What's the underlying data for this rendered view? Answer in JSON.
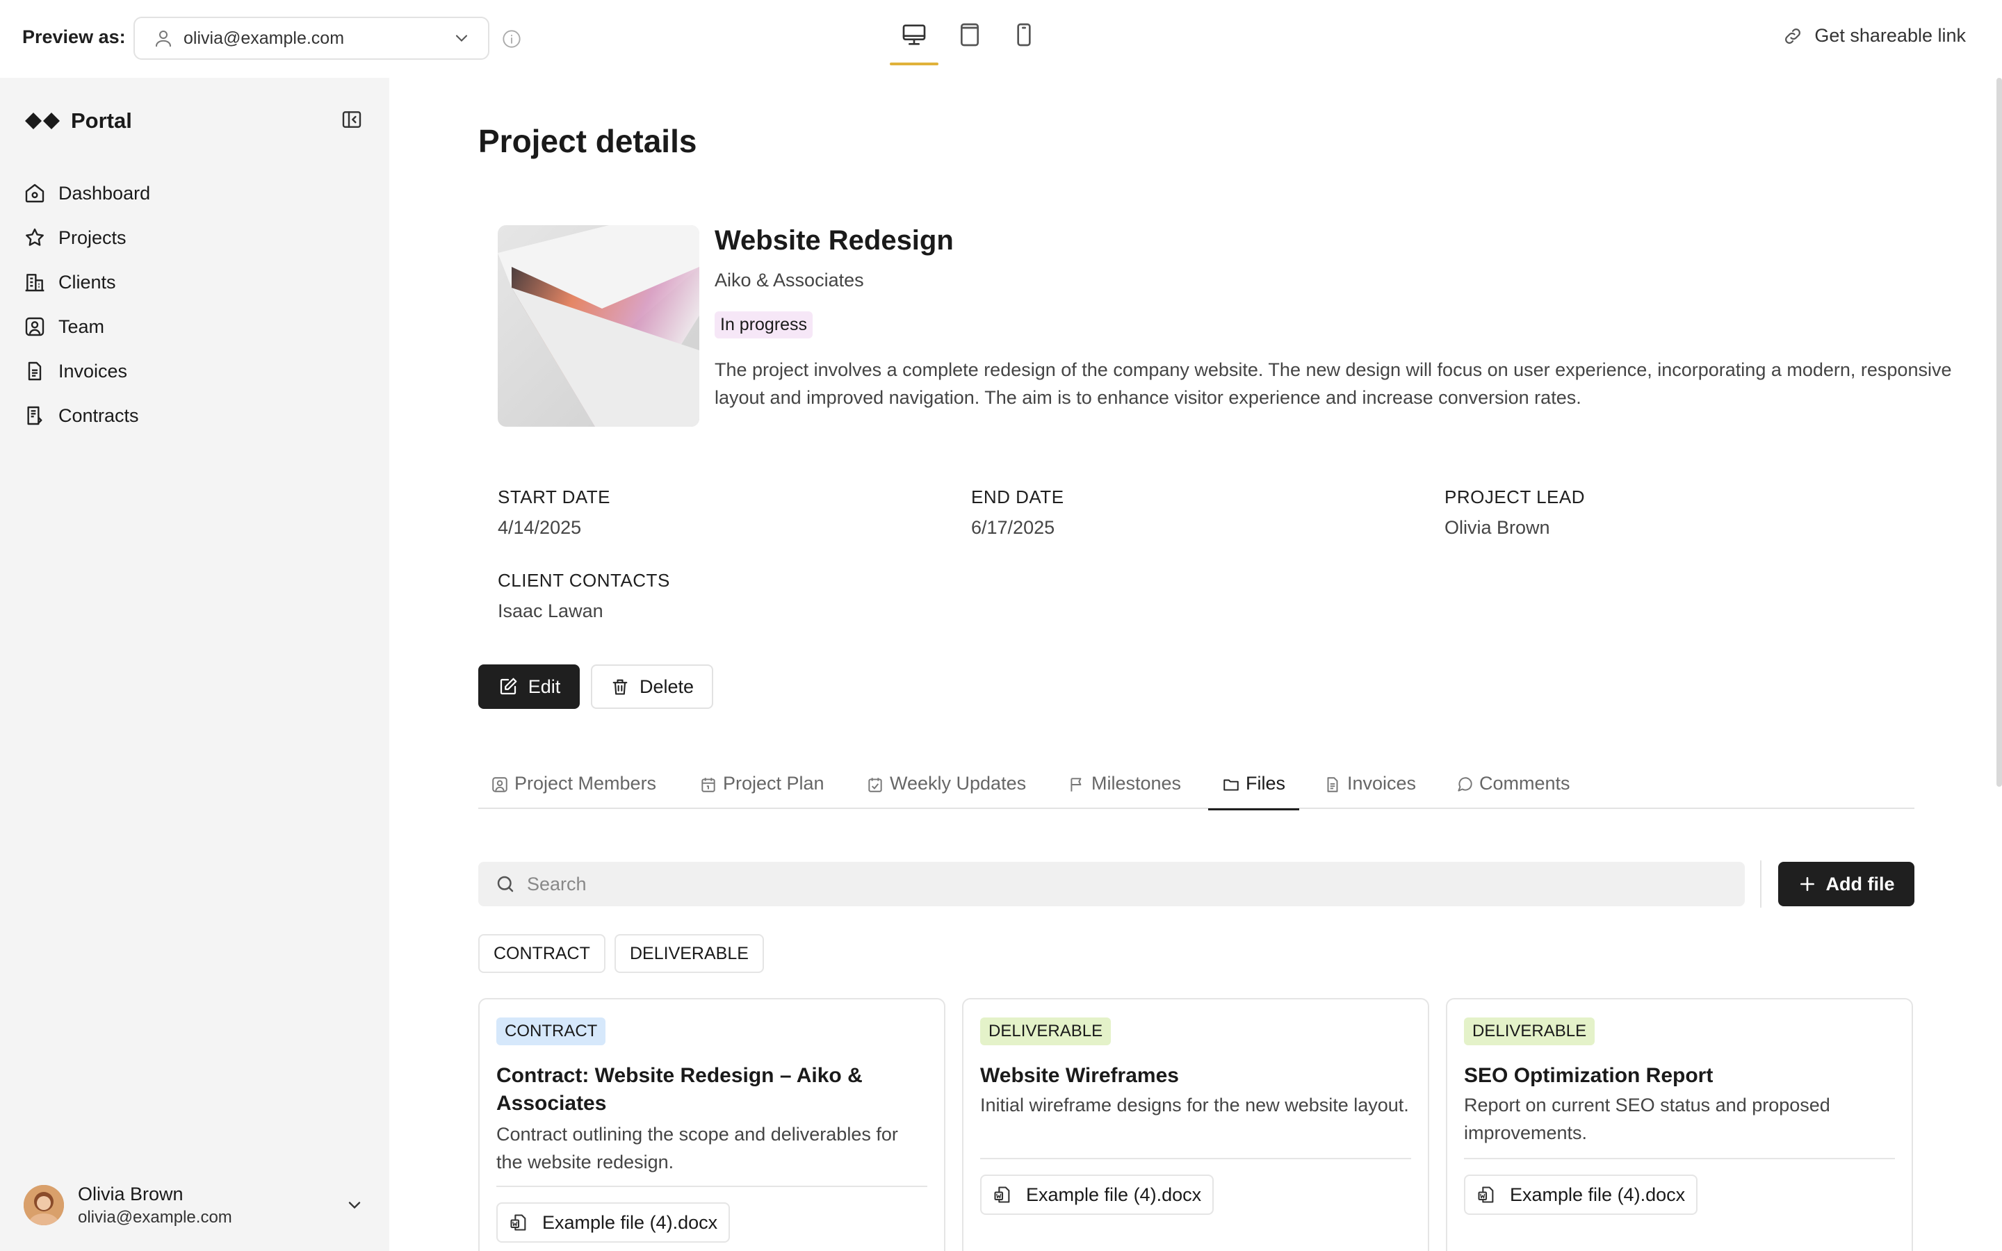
{
  "topbar": {
    "preview_label": "Preview as:",
    "preview_email": "olivia@example.com",
    "share_label": "Get shareable link",
    "active_device": "desktop"
  },
  "sidebar": {
    "brand": "Portal",
    "items": [
      {
        "label": "Dashboard",
        "icon": "home-icon"
      },
      {
        "label": "Projects",
        "icon": "star-icon"
      },
      {
        "label": "Clients",
        "icon": "building-icon"
      },
      {
        "label": "Team",
        "icon": "user-square-icon"
      },
      {
        "label": "Invoices",
        "icon": "document-icon"
      },
      {
        "label": "Contracts",
        "icon": "contract-icon"
      }
    ],
    "user": {
      "name": "Olivia Brown",
      "email": "olivia@example.com"
    }
  },
  "main": {
    "page_title": "Project details",
    "project": {
      "name": "Website Redesign",
      "client": "Aiko & Associates",
      "status": "In progress",
      "description": "The project involves a complete redesign of the company website. The new design will focus on user experience, incorporating a modern, responsive layout and improved navigation. The aim is to enhance visitor experience and increase conversion rates."
    },
    "meta": {
      "start_label": "START DATE",
      "start_value": "4/14/2025",
      "end_label": "END DATE",
      "end_value": "6/17/2025",
      "lead_label": "PROJECT LEAD",
      "lead_value": "Olivia Brown",
      "contacts_label": "CLIENT CONTACTS",
      "contacts_value": "Isaac Lawan"
    },
    "actions": {
      "edit": "Edit",
      "delete": "Delete"
    },
    "tabs": [
      {
        "label": "Project Members",
        "icon": "member-icon"
      },
      {
        "label": "Project Plan",
        "icon": "calendar-icon"
      },
      {
        "label": "Weekly Updates",
        "icon": "update-icon"
      },
      {
        "label": "Milestones",
        "icon": "flag-icon"
      },
      {
        "label": "Files",
        "icon": "folder-icon",
        "active": true
      },
      {
        "label": "Invoices",
        "icon": "document-icon"
      },
      {
        "label": "Comments",
        "icon": "comment-icon"
      }
    ],
    "search": {
      "placeholder": "Search"
    },
    "add_file": "Add file",
    "filters": [
      "CONTRACT",
      "DELIVERABLE"
    ],
    "files": [
      {
        "tag": "CONTRACT",
        "title": "Contract: Website Redesign – Aiko & Associates",
        "description": "Contract outlining the scope and deliverables for the website redesign.",
        "file": "Example file (4).docx"
      },
      {
        "tag": "DELIVERABLE",
        "title": "Website Wireframes",
        "description": "Initial wireframe designs for the new website layout.",
        "file": "Example file (4).docx"
      },
      {
        "tag": "DELIVERABLE",
        "title": "SEO Optimization Report",
        "description": "Report on current SEO status and proposed improvements.",
        "file": "Example file (4).docx"
      }
    ]
  },
  "colors": {
    "accent_underline": "#e0b23a",
    "primary_button": "#1f1f1f",
    "status_badge_bg": "#f6e7f7",
    "contract_tag_bg": "#d6e8fb",
    "deliverable_tag_bg": "#e4f2c9",
    "sidebar_bg": "#f4f4f4"
  }
}
